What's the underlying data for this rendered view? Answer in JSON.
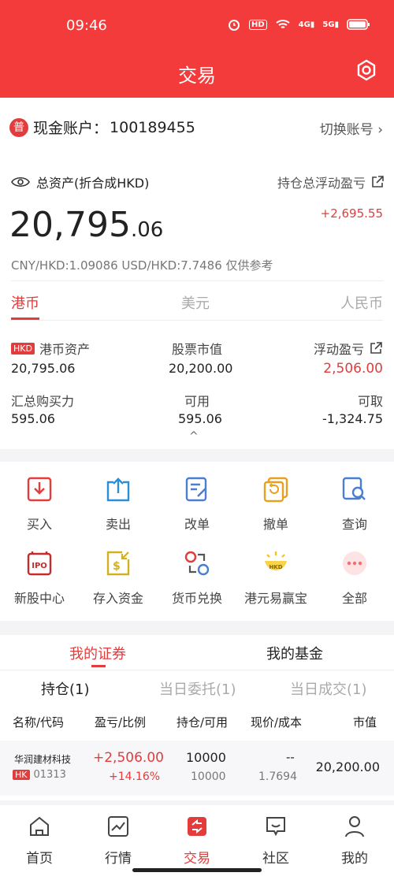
{
  "status_bar": {
    "time": "09:46",
    "icons": [
      "alarm-icon",
      "hd-icon",
      "wifi-icon",
      "4g-signal-icon",
      "5g-signal-icon",
      "battery-icon"
    ],
    "hd": "HD",
    "net1": "4G",
    "net2": "5G"
  },
  "header": {
    "title": "交易"
  },
  "account": {
    "badge": "普",
    "label": "现金账户：",
    "number": "100189455",
    "switch_label": "切换账号 ›",
    "total_label": "总资产(折合成HKD)",
    "float_pl_label": "持仓总浮动盈亏",
    "total_int": "20,795",
    "total_dec": ".06",
    "float_pl_value": "+2,695.55",
    "rate_note": "CNY/HKD:1.09086 USD/HKD:7.7486 仅供参考",
    "currency_tabs": [
      "港币",
      "美元",
      "人民币"
    ],
    "hkd_badge": "HKD",
    "cells": [
      {
        "label": "港币资产",
        "value": "20,795.06"
      },
      {
        "label": "股票市值",
        "value": "20,200.00"
      },
      {
        "label": "浮动盈亏",
        "value": "2,506.00"
      },
      {
        "label": "汇总购买力",
        "value": "595.06"
      },
      {
        "label": "可用",
        "value": "595.06"
      },
      {
        "label": "可取",
        "value": "-1,324.75"
      }
    ],
    "collapse": "^"
  },
  "actions": [
    {
      "label": "买入",
      "icon": "buy-icon"
    },
    {
      "label": "卖出",
      "icon": "sell-icon"
    },
    {
      "label": "改单",
      "icon": "edit-order-icon"
    },
    {
      "label": "撤单",
      "icon": "cancel-order-icon"
    },
    {
      "label": "查询",
      "icon": "query-icon"
    },
    {
      "label": "新股中心",
      "icon": "ipo-icon"
    },
    {
      "label": "存入资金",
      "icon": "deposit-icon"
    },
    {
      "label": "货币兑换",
      "icon": "exchange-icon"
    },
    {
      "label": "港元易赢宝",
      "icon": "hkd-treasure-icon"
    },
    {
      "label": "全部",
      "icon": "more-icon"
    }
  ],
  "ipo_text": "IPO",
  "hkd_text": "HKD",
  "securities": {
    "tabs": [
      "我的证券",
      "我的基金"
    ],
    "subtabs": [
      "持仓(1)",
      "当日委托(1)",
      "当日成交(1)"
    ],
    "columns": [
      "名称/代码",
      "盈亏/比例",
      "持仓/可用",
      "现价/成本",
      "市值"
    ],
    "rows": [
      {
        "name": "华润建材科技",
        "market": "HK",
        "code": "01313",
        "pl": "+2,506.00",
        "pl_pct": "+14.16%",
        "qty": "10000",
        "avail": "10000",
        "price": "--",
        "cost": "1.7694",
        "mkt_value": "20,200.00"
      }
    ]
  },
  "nav": [
    {
      "label": "首页",
      "icon": "home-icon"
    },
    {
      "label": "行情",
      "icon": "market-chart-icon"
    },
    {
      "label": "交易",
      "icon": "trade-icon"
    },
    {
      "label": "社区",
      "icon": "community-icon"
    },
    {
      "label": "我的",
      "icon": "profile-icon"
    }
  ],
  "colors": {
    "brand": "#f43b3b",
    "profit": "#e23c3c"
  }
}
